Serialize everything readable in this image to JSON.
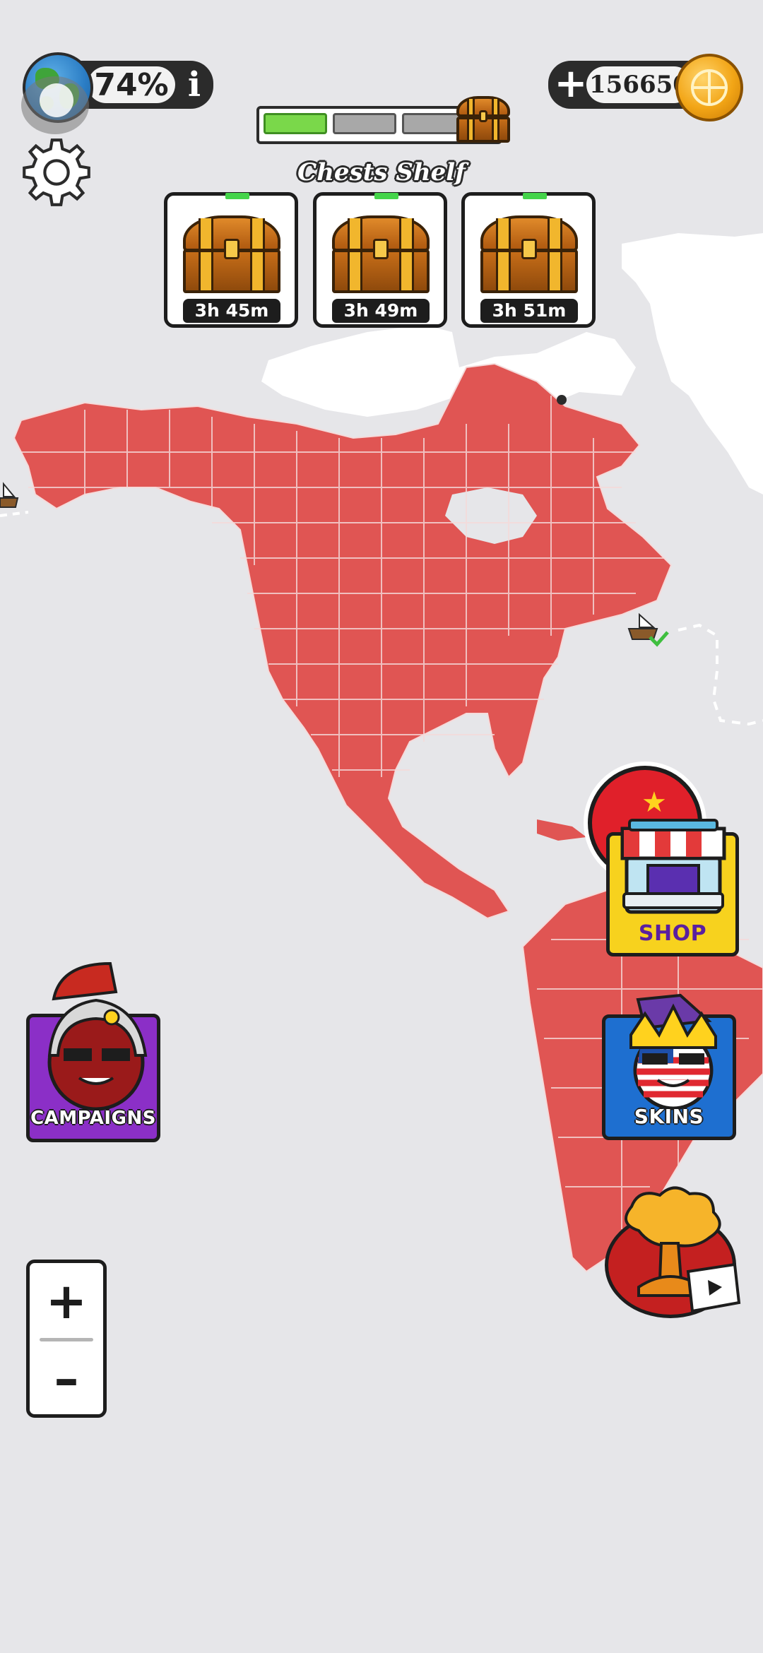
{
  "hud": {
    "world_percent": "74%",
    "info_label": "i",
    "coins": "156650",
    "plus_label": "+"
  },
  "progress": {
    "segments_total": 3,
    "segments_filled": 1
  },
  "chests_shelf": {
    "title": "Chests Shelf",
    "chests": [
      {
        "timer": "3h 45m"
      },
      {
        "timer": "3h 49m"
      },
      {
        "timer": "3h 51m"
      }
    ]
  },
  "buttons": {
    "shop": "SHOP",
    "skins": "SKINS",
    "campaigns": "CAMPAIGNS"
  },
  "zoom": {
    "plus": "+",
    "minus": "–"
  },
  "colors": {
    "territory": "#e05553",
    "background": "#e6e6e9",
    "shop_button": "#f7d21e",
    "skins_button": "#1e6fd0",
    "campaigns_button": "#8b2fc7"
  },
  "icons": [
    "earth-globe-icon",
    "info-icon",
    "plus-icon",
    "coin-globe-icon",
    "gear-icon",
    "chest-icon",
    "ship-icon",
    "explosion-icon",
    "video-icon"
  ]
}
